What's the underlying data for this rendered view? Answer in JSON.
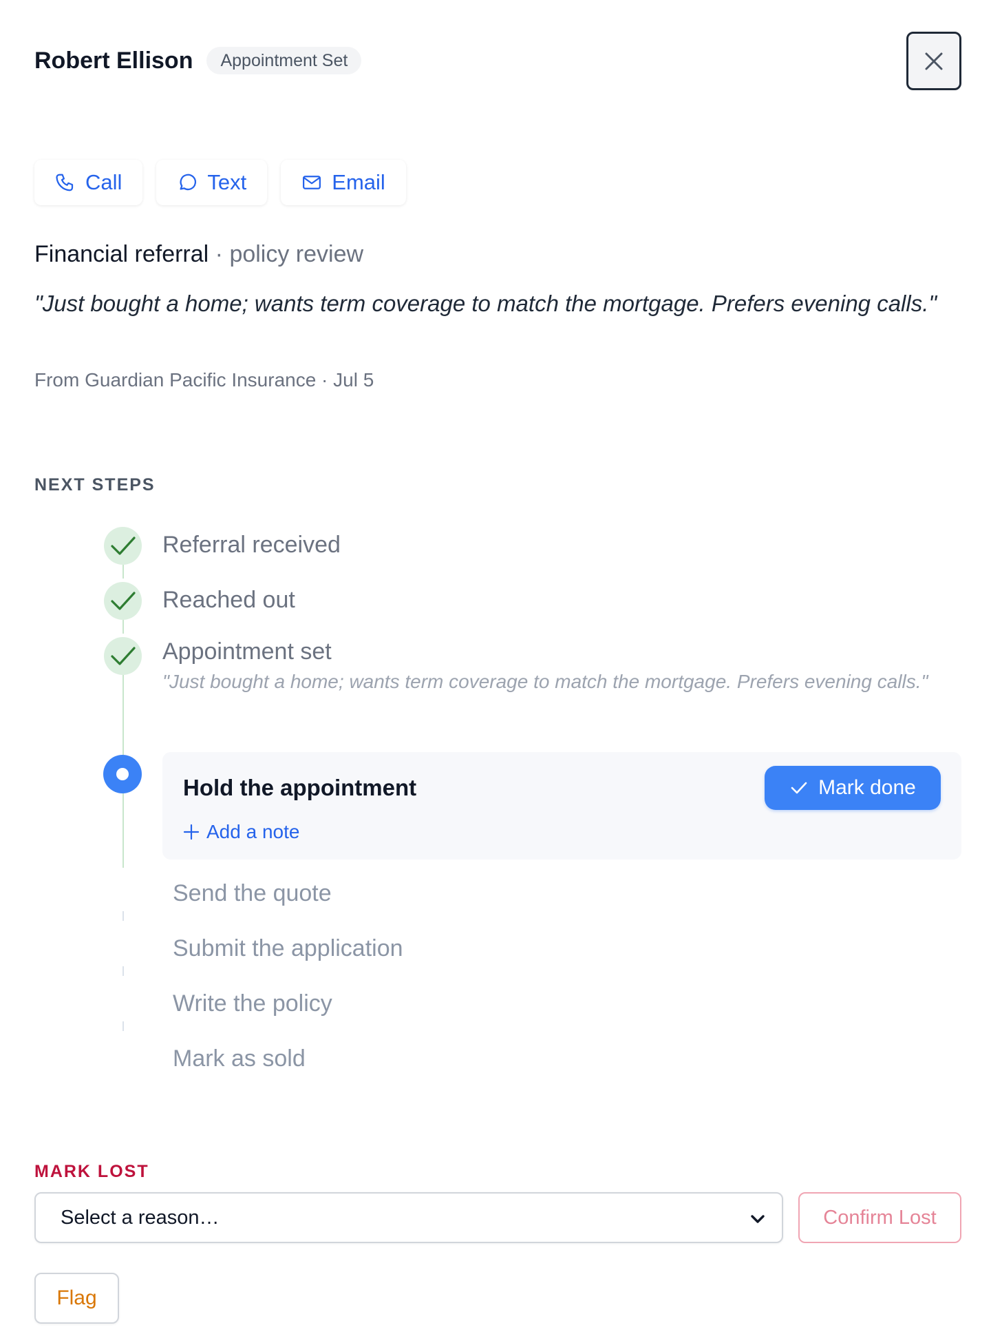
{
  "header": {
    "name": "Robert Ellison",
    "status": "Appointment Set",
    "close_icon": "close-icon"
  },
  "contact": {
    "call": "Call",
    "text": "Text",
    "email": "Email"
  },
  "referral": {
    "type": "Financial referral",
    "separator": " · ",
    "subtype": "policy review",
    "quote": "\"Just bought a home; wants term coverage to match the mortgage. Prefers evening calls.\"",
    "source": "From Guardian Pacific Insurance · Jul 5"
  },
  "next_steps": {
    "label": "NEXT STEPS",
    "completed": [
      {
        "label": "Referral received"
      },
      {
        "label": "Reached out"
      },
      {
        "label": "Appointment set",
        "note": "\"Just bought a home; wants term coverage to match the mortgage. Prefers evening calls.\""
      }
    ],
    "current": {
      "label": "Hold the appointment",
      "mark_done": "Mark done",
      "add_note": "Add a note"
    },
    "pending": [
      {
        "label": "Send the quote"
      },
      {
        "label": "Submit the application"
      },
      {
        "label": "Write the policy"
      },
      {
        "label": "Mark as sold"
      }
    ]
  },
  "mark_lost": {
    "label": "MARK LOST",
    "select_placeholder": "Select a reason…",
    "confirm": "Confirm Lost"
  },
  "flag": {
    "label": "Flag"
  },
  "colors": {
    "accent": "#3b82f6",
    "link": "#2563eb",
    "done_bg": "#dcefe0",
    "done_check": "#2e7d32",
    "danger": "#be123c",
    "flag": "#d97706"
  }
}
